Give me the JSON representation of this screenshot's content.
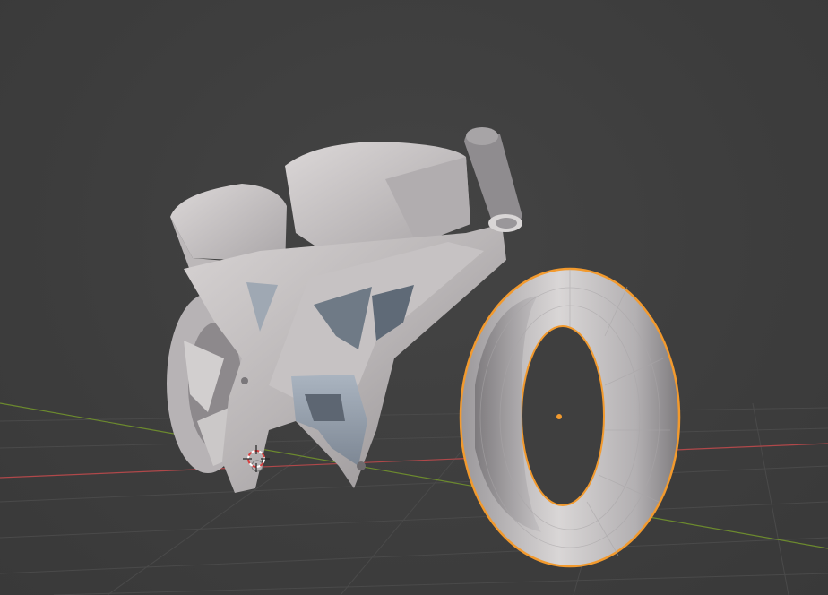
{
  "viewport": {
    "mode": "solid-shading",
    "background_color": "#3d3d3d",
    "grid_color": "#4a4a4a",
    "x_axis_color": "#b0484a",
    "y_axis_color": "#6c8a2e",
    "selection_outline_color": "#f29a2e",
    "origin_dot_color": "#f29a2e",
    "mesh_base_color": "#cfcccc"
  },
  "scene": {
    "objects": [
      {
        "name": "motorcycle-body",
        "selected": false
      },
      {
        "name": "front-tire",
        "selected": true
      }
    ],
    "cursor": "3d-cursor"
  }
}
